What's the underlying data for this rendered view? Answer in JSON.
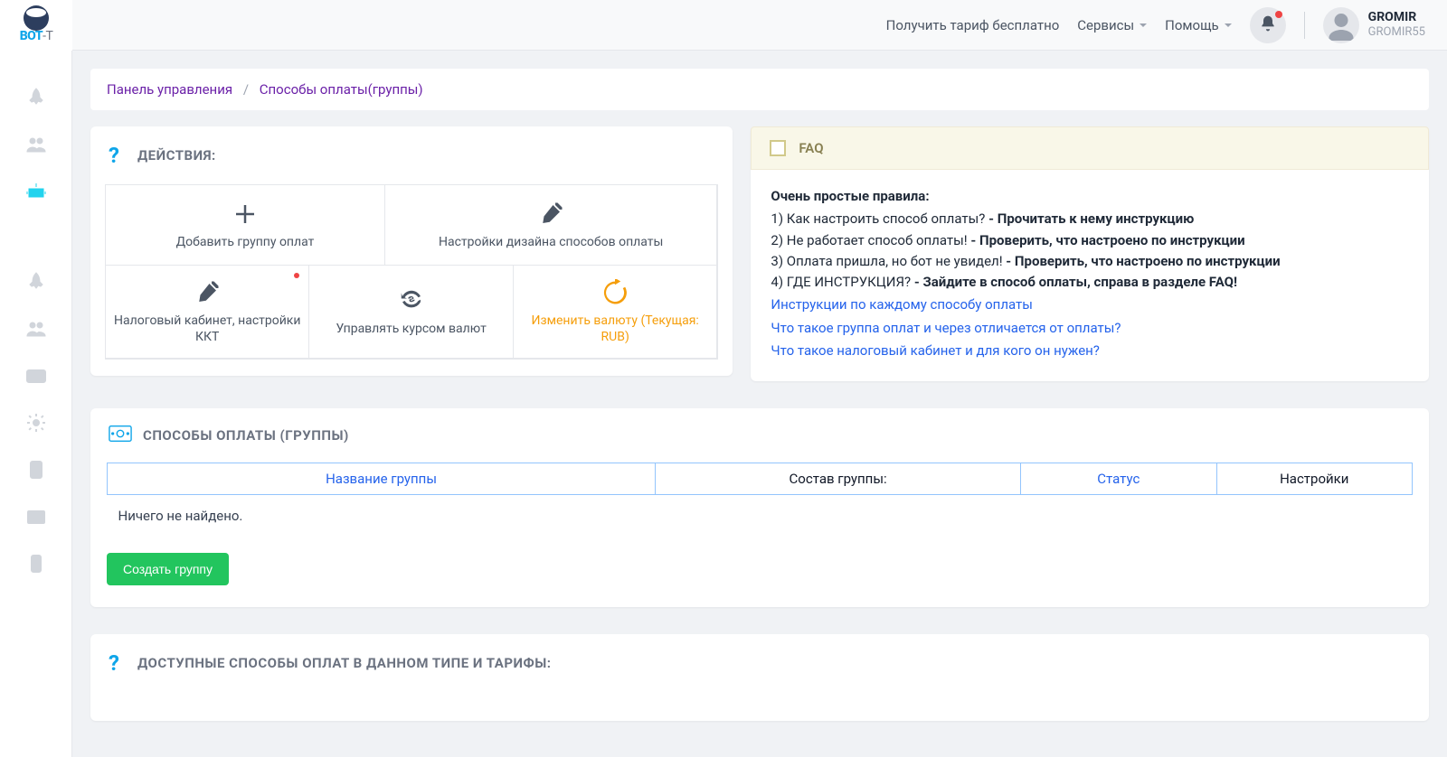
{
  "header": {
    "tariff_link": "Получить тариф бесплатно",
    "services": "Сервисы",
    "help": "Помощь",
    "user": {
      "name": "GROMIR",
      "login": "GROMIR55"
    }
  },
  "breadcrumb": {
    "dashboard": "Панель управления",
    "current": "Способы оплаты(группы)"
  },
  "actions_card": {
    "title": "ДЕЙСТВИЯ:",
    "add_group": "Добавить группу оплат",
    "design_settings": "Настройки дизайна способов оплаты",
    "tax_cabinet": "Налоговый кабинет, настройки ККТ",
    "currency_rate": "Управлять курсом валют",
    "change_currency": "Изменить валюту (Текущая: RUB)"
  },
  "faq_card": {
    "banner": "FAQ",
    "rules_title": "Очень простые правила:",
    "r1_q": "1) Как настроить способ оплаты? ",
    "r1_a": "- Прочитать к нему инструкцию",
    "r2_q": "2) Не работает способ оплаты! ",
    "r2_a": "- Проверить, что настроено по инструкции",
    "r3_q": "3) Оплата пришла, но бот не увидел! ",
    "r3_a": "- Проверить, что настроено по инструкции",
    "r4_q": "4) ГДЕ ИНСТРУКЦИЯ? ",
    "r4_a": "- Зайдите в способ оплаты, справа в разделе FAQ!",
    "link1": "Инструкции по каждому способу оплаты",
    "link2": "Что такое группа оплат и через отличается от оплаты?",
    "link3": "Что такое налоговый кабинет и для кого он нужен?"
  },
  "groups_card": {
    "title": "СПОСОБЫ ОПЛАТЫ (ГРУППЫ)",
    "col_name": "Название группы",
    "col_members": "Состав группы:",
    "col_status": "Статус",
    "col_settings": "Настройки",
    "empty": "Ничего не найдено.",
    "create_btn": "Создать группу"
  },
  "avail_card": {
    "title": "ДОСТУПНЫЕ СПОСОБЫ ОПЛАТ В ДАННОМ ТИПЕ И ТАРИФЫ:"
  }
}
